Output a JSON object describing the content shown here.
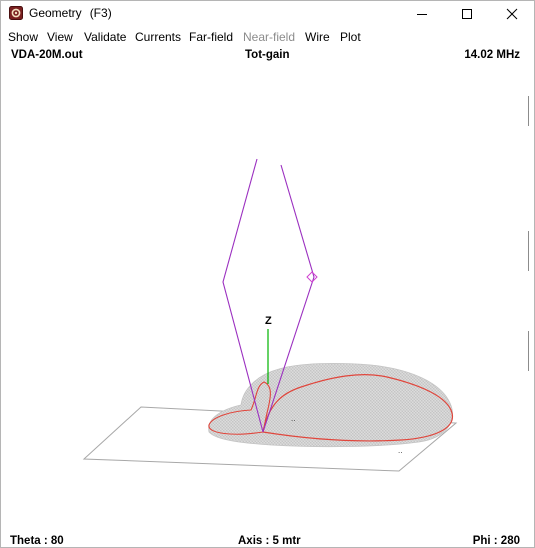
{
  "window": {
    "title": "Geometry",
    "shortcut": "(F3)",
    "icon": "app-logo-icon",
    "controls": [
      "minimize-icon",
      "maximize-icon",
      "close-icon"
    ]
  },
  "menu": {
    "items": [
      {
        "label": "Show",
        "enabled": true
      },
      {
        "label": "View",
        "enabled": true
      },
      {
        "label": "Validate",
        "enabled": true
      },
      {
        "label": "Currents",
        "enabled": true
      },
      {
        "label": "Far-field",
        "enabled": true
      },
      {
        "label": "Near-field",
        "enabled": false
      },
      {
        "label": "Wire",
        "enabled": true
      },
      {
        "label": "Plot",
        "enabled": true
      }
    ]
  },
  "info": {
    "filename": "VDA-20M.out",
    "mode": "Tot-gain",
    "frequency": "14.02 MHz"
  },
  "view": {
    "axis_label": "Z",
    "colors": {
      "antenna_wire": "#9b30c0",
      "z_axis": "#00b400",
      "pattern_fill": "#c8c8c8",
      "pattern_outline": "#e0463c",
      "ground_plane": "#a0a0a0"
    }
  },
  "status": {
    "theta": "Theta : 80",
    "axis": "Axis : 5 mtr",
    "phi": "Phi : 280"
  }
}
